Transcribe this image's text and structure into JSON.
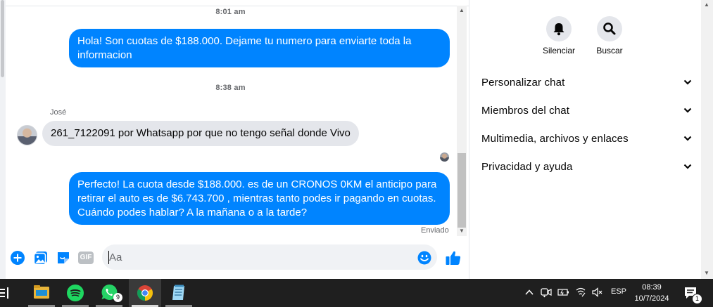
{
  "chat": {
    "timestamp_1": "8:01 am",
    "timestamp_2": "8:38 am",
    "sender_name": "José",
    "messages": [
      {
        "direction": "out",
        "text": "Hola! Son cuotas de $188.000. Dejame tu numero para enviarte toda la informacion"
      },
      {
        "direction": "in",
        "text": "261_7122091 por Whatsapp por que no tengo señal donde Vivo"
      },
      {
        "direction": "out",
        "text": "Perfecto! La cuota desde $188.000. es de un CRONOS 0KM el anticipo para retirar el auto es de $6.743.700 , mientras tanto podes ir pagando en cuotas. Cuándo podes hablar? A la mañana o a la tarde?"
      }
    ],
    "status": "Enviado"
  },
  "composer": {
    "placeholder": "Aa",
    "icons": [
      "plus-circle-icon",
      "image-icon",
      "sticker-icon",
      "gif-icon",
      "emoji-icon",
      "like-icon"
    ],
    "gif_label": "GIF"
  },
  "info_panel": {
    "actions": [
      {
        "label": "Silenciar",
        "icon": "bell-icon"
      },
      {
        "label": "Buscar",
        "icon": "search-icon"
      }
    ],
    "menu": [
      {
        "label": "Personalizar chat"
      },
      {
        "label": "Miembros del chat"
      },
      {
        "label": "Multimedia, archivos y enlaces"
      },
      {
        "label": "Privacidad y ayuda"
      }
    ]
  },
  "taskbar": {
    "apps": [
      "task-view-icon",
      "file-explorer-icon",
      "spotify-icon",
      "whatsapp-icon",
      "chrome-icon",
      "notepad-icon"
    ],
    "whatsapp_badge": "9",
    "language": "ESP",
    "time": "08:39",
    "date": "10/7/2024",
    "notification_count": "1"
  },
  "colors": {
    "accent": "#0084ff",
    "incoming_bubble": "#e4e6eb",
    "taskbar": "#1f1f1f"
  }
}
